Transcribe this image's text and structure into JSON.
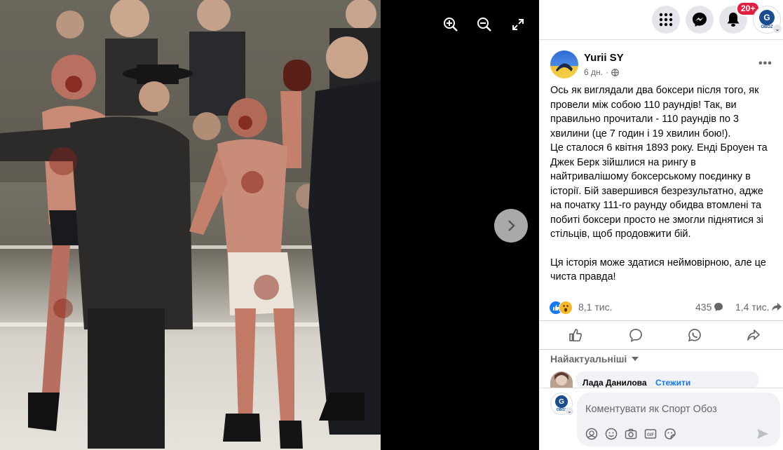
{
  "viewer": {
    "controls": {
      "zoom_in": "zoom-in-icon",
      "zoom_out": "zoom-out-icon",
      "fullscreen": "fullscreen-icon",
      "next": "chevron-right-icon"
    }
  },
  "topbar": {
    "notifications_badge": "20+",
    "profile_name": "OBOZ"
  },
  "post": {
    "author": "Yurii SY",
    "time": "6 дн.",
    "paragraphs": [
      "Ось як виглядали два боксери після того, як провели між собою 110 раундів! Так, ви правильно прочитали - 110 раундів по 3 хвилини (це 7 годин і 19 хвилин бою!).",
      "Це сталося 6 квітня 1893 року. Енді Броуен та Джек Берк зійшлися на рингу в найтривалішому боксерському поєдинку в історії. Бій завершився безрезультатно, адже на початку 111-го раунду обидва втомлені та побиті боксери просто не змогли піднятися зі стільців, щоб продовжити бій.",
      "Ця історія може здатися неймовірною, але це чиста правда!"
    ],
    "reactions_count": "8,1 тис.",
    "comments_count": "435",
    "shares_count": "1,4 тис."
  },
  "comments": {
    "sort_label": "Найактуальніші",
    "peek_author": "Лада Данилова",
    "peek_action": "Стежити"
  },
  "composer": {
    "placeholder": "Коментувати як Спорт Обоз",
    "avatar_label": "OBOZ"
  },
  "colors": {
    "fb_blue": "#1877f2",
    "badge_red": "#e41e3f",
    "panel_bg": "#ffffff",
    "input_bg": "#f0f2f5"
  }
}
